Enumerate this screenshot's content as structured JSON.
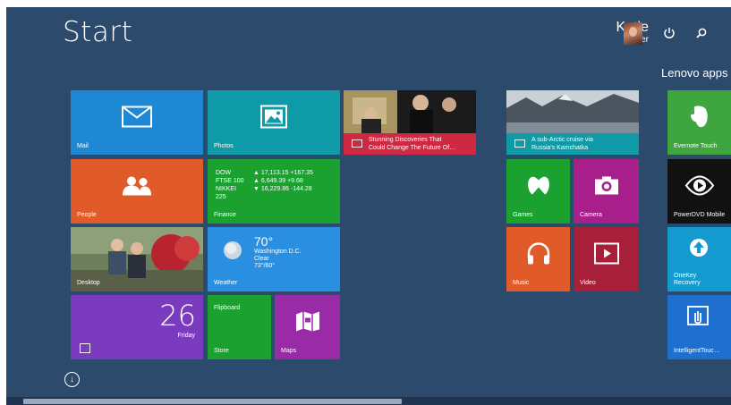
{
  "header": {
    "title": "Start",
    "user_first": "Katie",
    "user_last": "Meyer",
    "power_icon": "power-icon",
    "search_icon": "search-icon"
  },
  "groups": {
    "lenovo_title": "Lenovo apps"
  },
  "tiles": {
    "mail": "Mail",
    "photos": "Photos",
    "news_headline_1": "Stunning Discoveries That",
    "news_headline_2": "Could Change The Future Of…",
    "travel_line_1": "A sub-Arctic cruise via",
    "travel_line_2": "Russia's Kamchatka",
    "evernote": "Evernote Touch",
    "people": "People",
    "finance": "Finance",
    "finance_rows": [
      {
        "name": "DOW",
        "value": "▲ 17,113.15 +167.35"
      },
      {
        "name": "FTSE 100",
        "value": "▲ 6,649.39 +9.68"
      },
      {
        "name": "NIKKEI 225",
        "value": "▼ 16,229.86 -144.28"
      }
    ],
    "games": "Games",
    "camera": "Camera",
    "powerdvd": "PowerDVD Mobile",
    "desktop": "Desktop",
    "weather": "Weather",
    "weather_temp": "70°",
    "weather_city": "Washington D.C.",
    "weather_cond": "Clear",
    "weather_range": "73°/60°",
    "music": "Music",
    "video": "Video",
    "onekey_1": "OneKey",
    "onekey_2": "Recovery",
    "calendar_day": "26",
    "calendar_weekday": "Friday",
    "flipboard": "Flipboard",
    "store": "Store",
    "maps": "Maps",
    "intelligenttouch": "IntelligentTouc…"
  },
  "colors": {
    "background": "#2c4a6b",
    "mail": "#1e88d5",
    "photos": "#0e9aa6",
    "people": "#e05a2a",
    "finance": "#1aa130",
    "weather": "#2a8fe0",
    "calendar": "#7b3bbf",
    "store": "#1aa130",
    "maps": "#9a2ba8",
    "news": "#cf2842",
    "travel": "#0e9aa6",
    "games": "#1aa130",
    "camera": "#a81f8b",
    "music": "#e05a2a",
    "video": "#a81f3a",
    "evernote": "#3fa63f",
    "powerdvd": "#111111",
    "onekey": "#159ad0",
    "intelligenttouch": "#1f6fce"
  }
}
